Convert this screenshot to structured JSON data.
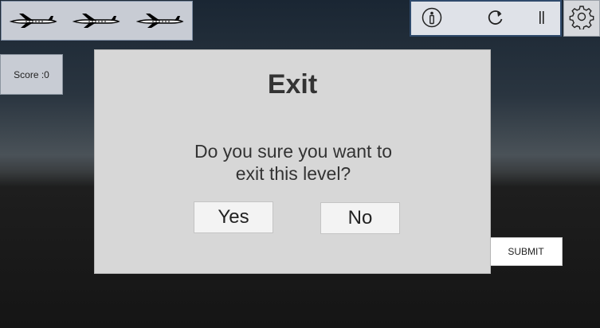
{
  "lives": {
    "icons": [
      "airplane-icon",
      "airplane-icon",
      "airplane-icon"
    ]
  },
  "toolbar": {
    "icons": [
      "info-icon",
      "restart-icon",
      "pause-icon",
      "gear-icon"
    ]
  },
  "score": {
    "label": "Score :0"
  },
  "submit": {
    "label": "SUBMIT"
  },
  "dialog": {
    "title": "Exit",
    "message_line1": "Do you sure you want to",
    "message_line2": "exit this level?",
    "yes_label": "Yes",
    "no_label": "No"
  },
  "colors": {
    "dialog_bg": "#d7d7d7",
    "panel_bg": "#c8ccd4",
    "toolbar_border": "#2f4a6c"
  }
}
